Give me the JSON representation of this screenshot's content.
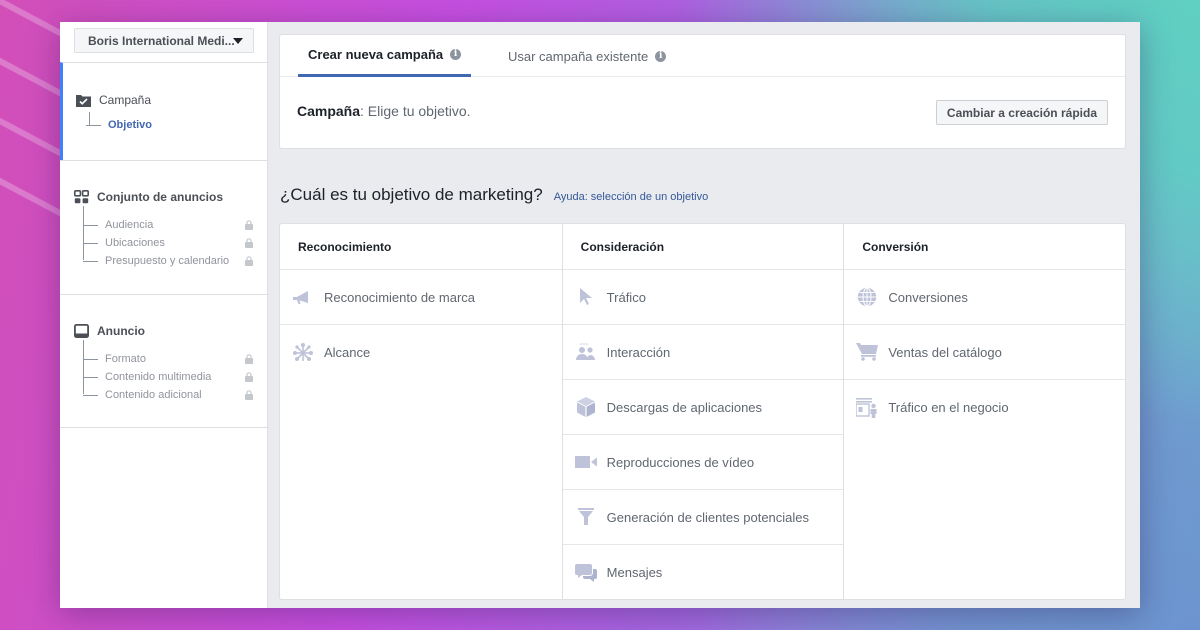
{
  "account": {
    "name": "Boris International Medi..."
  },
  "sidebar": {
    "sections": [
      {
        "title": "Campaña",
        "icon": "folder-check-icon",
        "items": [
          {
            "label": "Objetivo",
            "locked": false,
            "current": true
          }
        ]
      },
      {
        "title": "Conjunto de anuncios",
        "icon": "grid-icon",
        "items": [
          {
            "label": "Audiencia",
            "locked": true
          },
          {
            "label": "Ubicaciones",
            "locked": true
          },
          {
            "label": "Presupuesto y calendario",
            "locked": true
          }
        ]
      },
      {
        "title": "Anuncio",
        "icon": "monitor-icon",
        "items": [
          {
            "label": "Formato",
            "locked": true
          },
          {
            "label": "Contenido multimedia",
            "locked": true
          },
          {
            "label": "Contenido adicional",
            "locked": true
          }
        ]
      }
    ]
  },
  "tabs": [
    {
      "label": "Crear nueva campaña",
      "active": true,
      "info": "i"
    },
    {
      "label": "Usar campaña existente",
      "active": false,
      "info": "i"
    }
  ],
  "campaign": {
    "label": "Campaña",
    "text": ": Elige tu objetivo."
  },
  "quick_button": {
    "label": "Cambiar a creación rápida"
  },
  "question": {
    "text": "¿Cuál es tu objetivo de marketing?",
    "help_link": "Ayuda: selección de un objetivo"
  },
  "columns": [
    {
      "title": "Reconocimiento",
      "objectives": [
        {
          "label": "Reconocimiento de marca",
          "icon": "megaphone-icon"
        },
        {
          "label": "Alcance",
          "icon": "reach-icon"
        }
      ]
    },
    {
      "title": "Consideración",
      "objectives": [
        {
          "label": "Tráfico",
          "icon": "cursor-icon"
        },
        {
          "label": "Interacción",
          "icon": "people-icon"
        },
        {
          "label": "Descargas de aplicaciones",
          "icon": "box-icon"
        },
        {
          "label": "Reproducciones de vídeo",
          "icon": "video-camera-icon"
        },
        {
          "label": "Generación de clientes potenciales",
          "icon": "funnel-icon"
        },
        {
          "label": "Mensajes",
          "icon": "chat-bubbles-icon"
        }
      ]
    },
    {
      "title": "Conversión",
      "objectives": [
        {
          "label": "Conversiones",
          "icon": "globe-icon"
        },
        {
          "label": "Ventas del catálogo",
          "icon": "cart-icon"
        },
        {
          "label": "Tráfico en el negocio",
          "icon": "store-icon"
        }
      ]
    }
  ],
  "colors": {
    "accent": "#4267b2",
    "active_bar": "#4080ff",
    "icon": "#bec3d9"
  }
}
